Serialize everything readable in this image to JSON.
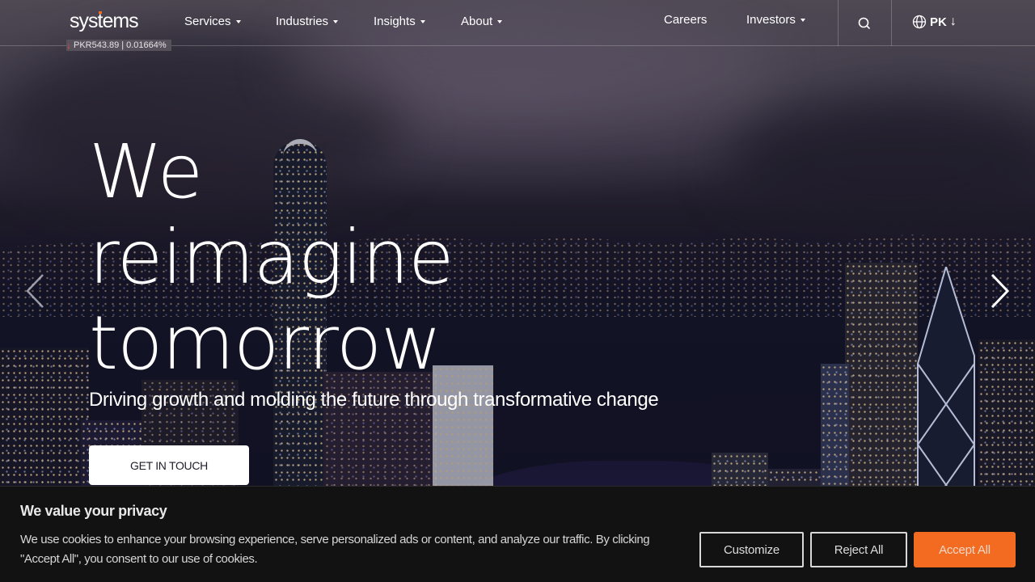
{
  "header": {
    "logo_text_pre": "sys",
    "logo_text_t": "t",
    "logo_text_post": "ems",
    "ticker": {
      "direction_icon": "arrow-down-icon",
      "price": "PKR543.89",
      "separator": "|",
      "change": "0.01664%"
    },
    "nav": [
      {
        "label": "Services",
        "has_dropdown": true
      },
      {
        "label": "Industries",
        "has_dropdown": true
      },
      {
        "label": "Insights",
        "has_dropdown": true
      },
      {
        "label": "About",
        "has_dropdown": true
      }
    ],
    "secondary_nav": [
      {
        "label": "Careers",
        "has_dropdown": false
      },
      {
        "label": "Investors",
        "has_dropdown": true
      }
    ],
    "search_icon": "search-icon",
    "language": {
      "icon": "globe-icon",
      "label": "PK",
      "arrow": "↓"
    }
  },
  "hero": {
    "headline_lines": [
      "We",
      "reimagine",
      "tomorrow"
    ],
    "subheadline": "Driving growth and molding the future through transformative change",
    "cta_label": "GET IN TOUCH",
    "prev_icon": "chevron-left-icon",
    "next_icon": "chevron-right-icon"
  },
  "cookie_banner": {
    "title": "We value your privacy",
    "text": "We use cookies to enhance your browsing experience, serve personalized ads or content, and analyze our traffic. By clicking \"Accept All\", you consent to our use of cookies.",
    "buttons": {
      "customize": "Customize",
      "reject": "Reject All",
      "accept": "Accept All"
    }
  },
  "colors": {
    "accent": "#f26b21",
    "ticker_down": "#e5484d",
    "banner_bg": "#121212"
  }
}
